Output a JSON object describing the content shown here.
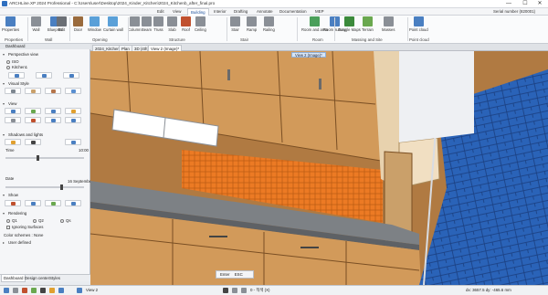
{
  "titlebar": {
    "title": "ARCHLine.XP 2024 Professional - C:\\Users\\user\\Desktop\\2024_Kinder_Kitchen\\2024_Kitchenb_after_final.pro",
    "minimize": "—",
    "maximize": "☐",
    "close": "✕"
  },
  "menu": {
    "tabs": [
      "Edit",
      "View",
      "Building",
      "Interior",
      "Drafting",
      "Annotate",
      "Documentation",
      "MEP"
    ],
    "active": "Building",
    "serial": "Serial number (820001)"
  },
  "ribbon": {
    "buttons": [
      {
        "label": "Properties",
        "icon": "properties-icon",
        "color": "#4a7fc1"
      },
      {
        "label": "Wall",
        "icon": "wall-icon",
        "color": "#8a8f96"
      },
      {
        "label": "Blueprint",
        "icon": "blueprint-icon",
        "color": "#4a7fc1"
      },
      {
        "label": "Edit",
        "icon": "edit-icon",
        "color": "#6b6f75"
      },
      {
        "label": "Door",
        "icon": "door-icon",
        "color": "#9a6b3d"
      },
      {
        "label": "Window",
        "icon": "window-icon",
        "color": "#5aa0d8"
      },
      {
        "label": "Curtain wall",
        "icon": "curtain-wall-icon",
        "color": "#5aa0d8"
      },
      {
        "label": "Column",
        "icon": "column-icon",
        "color": "#8a8f96"
      },
      {
        "label": "Beam",
        "icon": "beam-icon",
        "color": "#8a8f96"
      },
      {
        "label": "Truss",
        "icon": "truss-icon",
        "color": "#8a8f96"
      },
      {
        "label": "Slab",
        "icon": "slab-icon",
        "color": "#8a8f96"
      },
      {
        "label": "Roof",
        "icon": "roof-icon",
        "color": "#c0502e"
      },
      {
        "label": "Ceiling",
        "icon": "ceiling-icon",
        "color": "#8a8f96"
      },
      {
        "label": "Stair",
        "icon": "stair-icon",
        "color": "#8a8f96"
      },
      {
        "label": "Ramp",
        "icon": "ramp-icon",
        "color": "#8a8f96"
      },
      {
        "label": "Railing",
        "icon": "railing-icon",
        "color": "#8a8f96"
      },
      {
        "label": "Room and area",
        "icon": "room-area-icon",
        "color": "#4a9f5a"
      },
      {
        "label": "Room survey",
        "icon": "room-survey-icon",
        "color": "#4a7fc1"
      },
      {
        "label": "Google Maps",
        "icon": "google-maps-icon",
        "color": "#3b8a3b"
      },
      {
        "label": "Terrain",
        "icon": "terrain-icon",
        "color": "#6aa84f"
      },
      {
        "label": "Masses",
        "icon": "masses-icon",
        "color": "#8a8f96"
      },
      {
        "label": "Point cloud",
        "icon": "point-cloud-icon",
        "color": "#4a7fc1"
      }
    ],
    "groups": [
      "Properties",
      "Wall",
      "Opening",
      "Structure",
      "Stair",
      "Room",
      "Massing and Site",
      "Point cloud"
    ]
  },
  "panel": {
    "title": "Dashboard",
    "sections": {
      "perspective": "Perspective view",
      "iso": "ISO",
      "kitchen": "Kitchen1",
      "visual": "Visual Style",
      "view": "View",
      "shadows": "Shadows and lights",
      "time_label": "Time",
      "time_value": "10:00",
      "date_label": "Date",
      "date_value": "16 September",
      "show": "Show",
      "rendering": "Rendering",
      "q1": "Q1",
      "q2": "Q2",
      "q3": "Qs",
      "ignoring": "Ignoring Surfaces",
      "color_schemes": "Color schemes : None",
      "user_defined": "User defined"
    },
    "bottom_tabs": [
      "Dashboard",
      "Design center",
      "Styles"
    ]
  },
  "doc_tabs": [
    "2024_Kitchen",
    "Plan",
    "3D (4th)",
    "View 2 (Image)*"
  ],
  "viewport": {
    "tag": "View 2 (Image)*",
    "colors": {
      "wood": "#d29a5a",
      "tile": "#ec7a24",
      "blue": "#2a63b8",
      "counter": "#7d8185",
      "window": "#ffffff"
    }
  },
  "command": {
    "enter": "Enter",
    "esc": "ESC"
  },
  "status": {
    "view": "View 2",
    "angle": "0 - 적색 (X)",
    "coords": "dx: 3657.5    dy: -465.6 mm"
  }
}
